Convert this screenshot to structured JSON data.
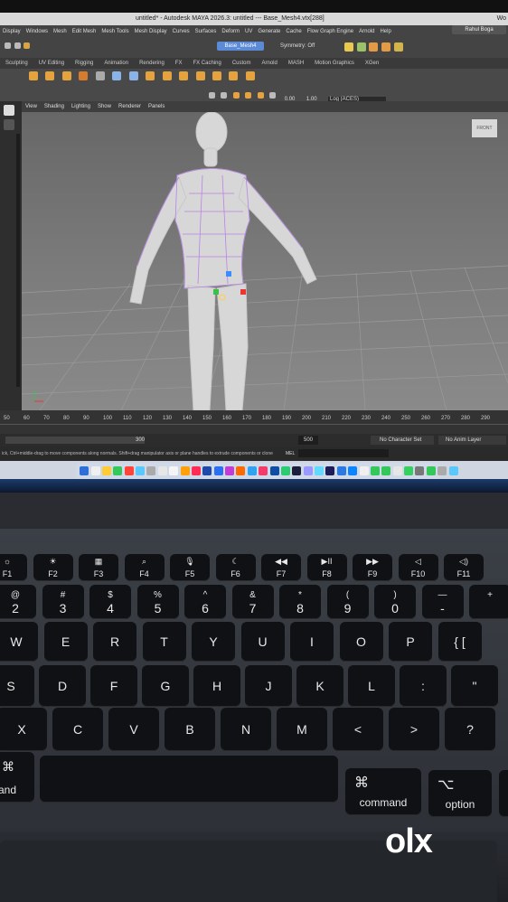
{
  "window": {
    "title": "untitled* - Autodesk MAYA 2026.3: untitled  ---  Base_Mesh4.vtx[288]",
    "corner_label": "Wo",
    "user": "Rahul Boga"
  },
  "menus": [
    "Display",
    "Windows",
    "Mesh",
    "Edit Mesh",
    "Mesh Tools",
    "Mesh Display",
    "Curves",
    "Surfaces",
    "Deform",
    "UV",
    "Generate",
    "Cache",
    "Flow Graph Engine",
    "Arnold",
    "Help"
  ],
  "object_field": "Base_Mesh4",
  "symmetry": "Symmetry: Off",
  "shelf_tabs": [
    "Sculpting",
    "UV Editing",
    "Rigging",
    "Animation",
    "Rendering",
    "FX",
    "FX Caching",
    "Custom",
    "Arnold",
    "MASH",
    "Motion Graphics",
    "XGen"
  ],
  "viewport_menu": [
    "View",
    "Shading",
    "Lighting",
    "Show",
    "Renderer",
    "Panels"
  ],
  "viewport": {
    "field_1": "0.00",
    "field_2": "1.00",
    "colorspace": "Log (ACES)",
    "view_cube": "FRONT"
  },
  "timeline": {
    "ticks": [
      "50",
      "60",
      "70",
      "80",
      "90",
      "100",
      "110",
      "120",
      "130",
      "140",
      "150",
      "160",
      "170",
      "180",
      "190",
      "200",
      "210",
      "220",
      "230",
      "240",
      "250",
      "260",
      "270",
      "280",
      "290"
    ],
    "range_end": "300",
    "range_field": "500",
    "character_set": "No Character Set",
    "anim_layer": "No Anim Layer"
  },
  "help_line": {
    "text": "ick, Ctrl+middle-drag to move components along normals. Shift+drag manipulator axis or plane handles to extrude components or clone",
    "mode": "MEL"
  },
  "dock_colors": [
    "#2d6fd6",
    "#f0f0f0",
    "#ffcc33",
    "#34c759",
    "#ff453a",
    "#5ac8fa",
    "#aaa",
    "#e6e6e6",
    "#f5f5f5",
    "#ff9f0a",
    "#ff2d55",
    "#1f4aa8",
    "#2b70f2",
    "#c23bd4",
    "#ff6a00",
    "#2ea3f2",
    "#f23c6c",
    "#0e4da3",
    "#2ecc71",
    "#1b1f3b",
    "#9999ff",
    "#61dafb",
    "#1d1d59",
    "#2a7ae4",
    "#0a84ff",
    "#f0f0f0",
    "#34c759",
    "#34c759",
    "#e6e6e6",
    "#35d05d",
    "#777",
    "#34c759",
    "#aaa",
    "#5ac8fa"
  ],
  "keyboard": {
    "fn_row": [
      {
        "icon": "☼",
        "label": "F1"
      },
      {
        "icon": "☀",
        "label": "F2"
      },
      {
        "icon": "▦",
        "label": "F3"
      },
      {
        "icon": "⌕",
        "label": "F4"
      },
      {
        "icon": "🎙",
        "label": "F5"
      },
      {
        "icon": "☾",
        "label": "F6"
      },
      {
        "icon": "◀◀",
        "label": "F7"
      },
      {
        "icon": "▶II",
        "label": "F8"
      },
      {
        "icon": "▶▶",
        "label": "F9"
      },
      {
        "icon": "◁",
        "label": "F10"
      },
      {
        "icon": "◁)",
        "label": "F11"
      }
    ],
    "number_row": [
      {
        "top": "@",
        "bot": "2"
      },
      {
        "top": "#",
        "bot": "3"
      },
      {
        "top": "$",
        "bot": "4"
      },
      {
        "top": "%",
        "bot": "5"
      },
      {
        "top": "^",
        "bot": "6"
      },
      {
        "top": "&",
        "bot": "7"
      },
      {
        "top": "*",
        "bot": "8"
      },
      {
        "top": "(",
        "bot": "9"
      },
      {
        "top": ")",
        "bot": "0"
      },
      {
        "top": "—",
        "bot": "-"
      },
      {
        "top": "+",
        "bot": ""
      }
    ],
    "qwerty_row": [
      "W",
      "E",
      "R",
      "T",
      "Y",
      "U",
      "I",
      "O",
      "P",
      "{ ["
    ],
    "home_row": [
      "S",
      "D",
      "F",
      "G",
      "H",
      "J",
      "K",
      "L",
      ":",
      "\""
    ],
    "bottom_row": [
      "X",
      "C",
      "V",
      "B",
      "N",
      "M",
      "<",
      ">",
      "?"
    ],
    "modifiers": {
      "left_cmd_icon": "⌘",
      "left_cmd_label": "and",
      "right_cmd_icon": "⌘",
      "right_cmd_label": "command",
      "option_icon": "⌥",
      "option_label": "option"
    }
  },
  "watermark": "olx"
}
